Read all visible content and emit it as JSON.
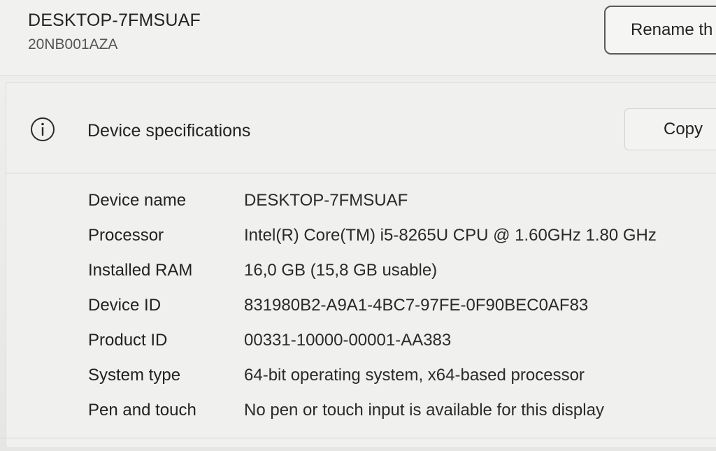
{
  "device": {
    "name": "DESKTOP-7FMSUAF",
    "model": "20NB001AZA",
    "rename_label": "Rename th"
  },
  "specs": {
    "title": "Device specifications",
    "copy_label": "Copy",
    "rows": [
      {
        "label": "Device name",
        "value": "DESKTOP-7FMSUAF"
      },
      {
        "label": "Processor",
        "value": "Intel(R) Core(TM) i5-8265U CPU @ 1.60GHz   1.80 GHz"
      },
      {
        "label": "Installed RAM",
        "value": "16,0 GB (15,8 GB usable)"
      },
      {
        "label": "Device ID",
        "value": "831980B2-A9A1-4BC7-97FE-0F90BEC0AF83"
      },
      {
        "label": "Product ID",
        "value": "00331-10000-00001-AA383"
      },
      {
        "label": "System type",
        "value": "64-bit operating system, x64-based processor"
      },
      {
        "label": "Pen and touch",
        "value": "No pen or touch input is available for this display"
      }
    ]
  },
  "icons": {
    "info": "info-icon"
  }
}
